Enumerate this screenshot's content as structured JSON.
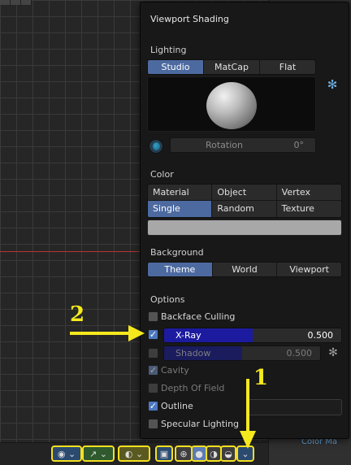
{
  "background_tabs": [
    "",
    "",
    ""
  ],
  "popup": {
    "title": "Viewport Shading",
    "lighting": {
      "label": "Lighting",
      "modes": [
        "Studio",
        "MatCap",
        "Flat"
      ],
      "active": "Studio",
      "rotation_label": "Rotation",
      "rotation_value": "0°"
    },
    "color": {
      "label": "Color",
      "modes": [
        "Material",
        "Object",
        "Vertex",
        "Single",
        "Random",
        "Texture"
      ],
      "active": "Single",
      "swatch": "#a8a8a8"
    },
    "background": {
      "label": "Background",
      "modes": [
        "Theme",
        "World",
        "Viewport"
      ],
      "active": "Theme"
    },
    "options": {
      "label": "Options",
      "backface_culling": {
        "label": "Backface Culling",
        "checked": false
      },
      "xray": {
        "label": "X-Ray",
        "checked": true,
        "value": "0.500",
        "fraction": 0.5
      },
      "shadow": {
        "label": "Shadow",
        "checked": false,
        "value": "0.500",
        "fraction": 0.5
      },
      "cavity": {
        "label": "Cavity",
        "checked": true,
        "enabled": false
      },
      "depth_of_field": {
        "label": "Depth Of Field",
        "checked": false,
        "enabled": false
      },
      "outline": {
        "label": "Outline",
        "checked": true
      },
      "specular": {
        "label": "Specular Lighting",
        "checked": false
      }
    }
  },
  "annotations": {
    "arrow_1": "1",
    "arrow_2": "2"
  },
  "right_panel": {
    "color_text": "Color Ma"
  },
  "colors": {
    "accent_active": "#4d6aa0",
    "checkbox_on": "#4d78c0",
    "slider_fill": "#1c1ba0",
    "annotation_yellow": "#f5e91e",
    "highlight_outline": "#f5e020"
  }
}
